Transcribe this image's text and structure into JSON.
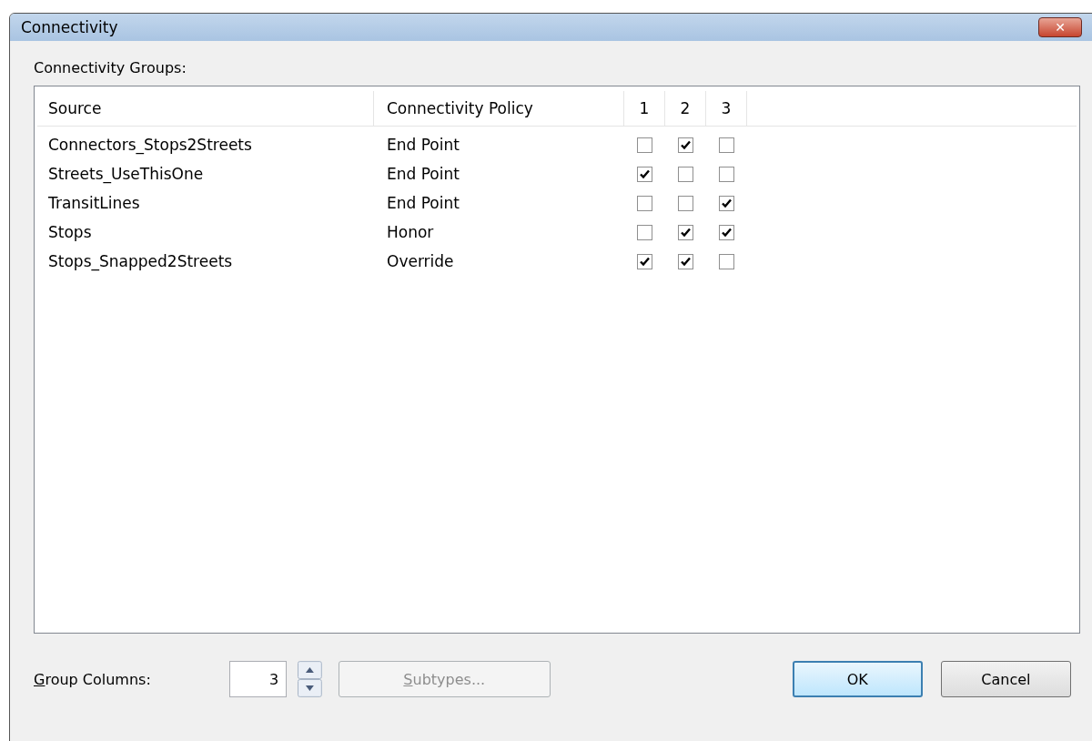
{
  "window": {
    "title": "Connectivity",
    "close": "✕"
  },
  "groups_label": "Connectivity Groups:",
  "table": {
    "columns": [
      "Source",
      "Connectivity Policy",
      "1",
      "2",
      "3"
    ],
    "rows": [
      {
        "source": "Connectors_Stops2Streets",
        "policy": "End Point",
        "groups": [
          false,
          true,
          false
        ]
      },
      {
        "source": "Streets_UseThisOne",
        "policy": "End Point",
        "groups": [
          true,
          false,
          false
        ]
      },
      {
        "source": "TransitLines",
        "policy": "End Point",
        "groups": [
          false,
          false,
          true
        ]
      },
      {
        "source": "Stops",
        "policy": "Honor",
        "groups": [
          false,
          true,
          true
        ]
      },
      {
        "source": "Stops_Snapped2Streets",
        "policy": "Override",
        "groups": [
          true,
          true,
          false
        ]
      }
    ]
  },
  "group_columns": {
    "label": "Group Columns:",
    "value": "3"
  },
  "buttons": {
    "subtypes": {
      "label": "Subtypes...",
      "disabled": true
    },
    "ok": "OK",
    "cancel": "Cancel"
  }
}
